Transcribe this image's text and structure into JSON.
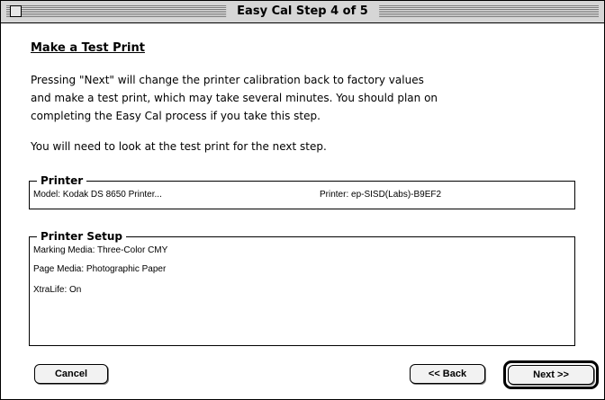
{
  "window": {
    "title": "Easy Cal Step 4 of 5"
  },
  "content": {
    "heading": "Make a Test Print",
    "paragraph_lines": [
      "Pressing \"Next\" will change the printer calibration back to factory values",
      "and make a test print, which may take several minutes.  You should plan on",
      "completing the Easy Cal process if you take this step."
    ],
    "note": "You will need to look at the test print for the next step."
  },
  "printer_group": {
    "label": "Printer",
    "model": "Model: Kodak DS 8650 Printer...",
    "printer": "Printer: ep-SISD(Labs)-B9EF2"
  },
  "setup_group": {
    "label": "Printer Setup",
    "lines": [
      "Marking Media: Three-Color CMY",
      "Page Media: Photographic Paper",
      "XtraLife: On"
    ]
  },
  "buttons": {
    "cancel": "Cancel",
    "back": "<< Back",
    "next": "Next >>"
  }
}
